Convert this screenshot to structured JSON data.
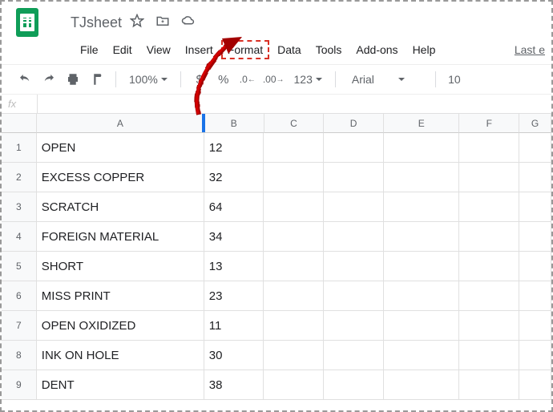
{
  "header": {
    "doc_title": "TJsheet"
  },
  "menubar": {
    "items": [
      "File",
      "Edit",
      "View",
      "Insert",
      "Format",
      "Data",
      "Tools",
      "Add-ons",
      "Help"
    ],
    "highlighted_index": 4,
    "last_edit": "Last e"
  },
  "toolbar": {
    "zoom": "100%",
    "currency": "$",
    "percent": "%",
    "num_format": "123",
    "font": "Arial",
    "font_size": "10"
  },
  "formula_bar": {
    "fx": "fx",
    "value": ""
  },
  "columns": [
    "A",
    "B",
    "C",
    "D",
    "E",
    "F",
    "G"
  ],
  "rows": [
    {
      "n": "1",
      "a": "OPEN",
      "b": "12"
    },
    {
      "n": "2",
      "a": "EXCESS COPPER",
      "b": "32"
    },
    {
      "n": "3",
      "a": "SCRATCH",
      "b": "64"
    },
    {
      "n": "4",
      "a": "FOREIGN MATERIAL",
      "b": "34"
    },
    {
      "n": "5",
      "a": "SHORT",
      "b": "13"
    },
    {
      "n": "6",
      "a": "MISS PRINT",
      "b": "23"
    },
    {
      "n": "7",
      "a": "OPEN OXIDIZED",
      "b": "11"
    },
    {
      "n": "8",
      "a": "INK ON HOLE",
      "b": "30"
    },
    {
      "n": "9",
      "a": "DENT",
      "b": "38"
    }
  ]
}
